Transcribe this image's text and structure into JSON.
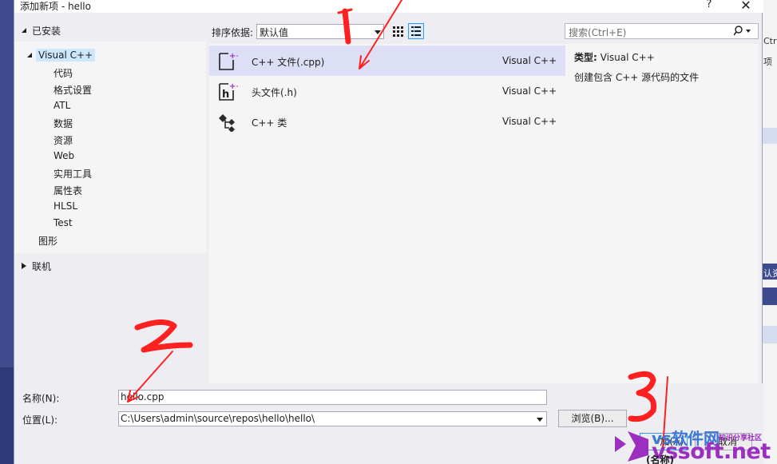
{
  "window": {
    "title": "添加新项 - hello",
    "help_label": "?",
    "close_label": "✕"
  },
  "left_pane": {
    "installed_label": "已安装",
    "tree_root": "Visual C++",
    "tree_children": [
      "代码",
      "格式设置",
      "ATL",
      "数据",
      "资源",
      "Web",
      "实用工具",
      "属性表",
      "HLSL",
      "Test"
    ],
    "graphics_label": "图形",
    "online_label": "联机"
  },
  "toolbar": {
    "sort_label": "排序依据:",
    "sort_value": "默认值"
  },
  "templates": [
    {
      "name": "C++ 文件(.cpp)",
      "lang": "Visual C++",
      "icon": "cpp-file-icon"
    },
    {
      "name": "头文件(.h)",
      "lang": "Visual C++",
      "icon": "header-file-icon"
    },
    {
      "name": "C++ 类",
      "lang": "Visual C++",
      "icon": "cpp-class-icon"
    }
  ],
  "search": {
    "placeholder": "搜索(Ctrl+E)"
  },
  "details": {
    "type_label": "类型:",
    "type_value": "Visual C++",
    "description": "创建包含 C++ 源代码的文件"
  },
  "form": {
    "name_label": "名称(N):",
    "name_value": "hello.cpp",
    "location_label": "位置(L):",
    "location_value": "C:\\Users\\admin\\source\\repos\\hello\\hello\\",
    "browse_label": "浏览(B)...",
    "add_label": "加(A)",
    "cancel_label": "取消"
  },
  "annotations": {
    "marks": [
      "1",
      "2",
      "3"
    ],
    "color": "#ff2020"
  },
  "background_ide": {
    "right_texts": [
      "Ctr",
      "项",
      "认资"
    ],
    "bottom_text": "(名称)"
  },
  "watermark": {
    "cn": "vs软件网",
    "sub": "知识分享社区",
    "en": "vssoft.net"
  },
  "colors": {
    "accent": "#3399ff",
    "selection": "#dcdff5",
    "watermark_blue": "#3c78d8",
    "watermark_purple": "#9b30c0"
  }
}
